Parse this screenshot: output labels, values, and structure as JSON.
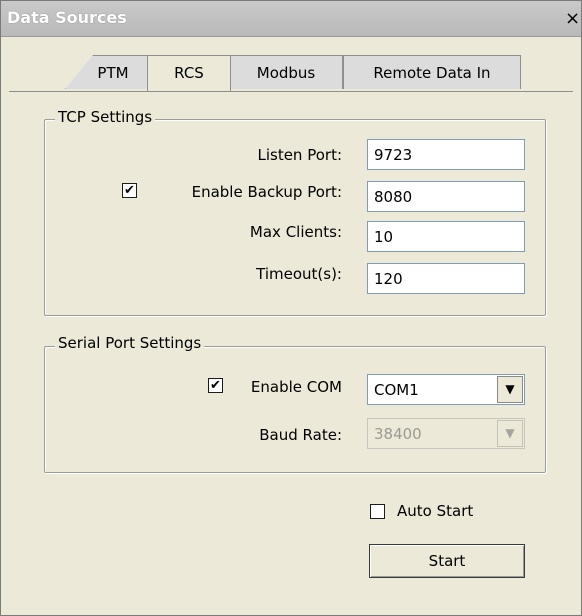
{
  "window": {
    "title": "Data Sources",
    "close_label": "×"
  },
  "tabs": [
    {
      "label": "PTM"
    },
    {
      "label": "RCS"
    },
    {
      "label": "Modbus"
    },
    {
      "label": "Remote Data In"
    }
  ],
  "active_tab": "RCS",
  "tcp": {
    "legend": "TCP Settings",
    "listen_port_label": "Listen Port:",
    "listen_port_value": "9723",
    "enable_backup_label": "Enable Backup Port:",
    "enable_backup_checked": true,
    "backup_port_value": "8080",
    "max_clients_label": "Max Clients:",
    "max_clients_value": "10",
    "timeout_label": "Timeout(s):",
    "timeout_value": "120"
  },
  "serial": {
    "legend": "Serial Port Settings",
    "enable_com_label": "Enable COM",
    "enable_com_checked": true,
    "com_value": "COM1",
    "baud_label": "Baud Rate:",
    "baud_value": "38400"
  },
  "footer": {
    "auto_start_label": "Auto Start",
    "auto_start_checked": false,
    "start_label": "Start"
  },
  "glyphs": {
    "check": "✔",
    "dropdown": "▼"
  }
}
